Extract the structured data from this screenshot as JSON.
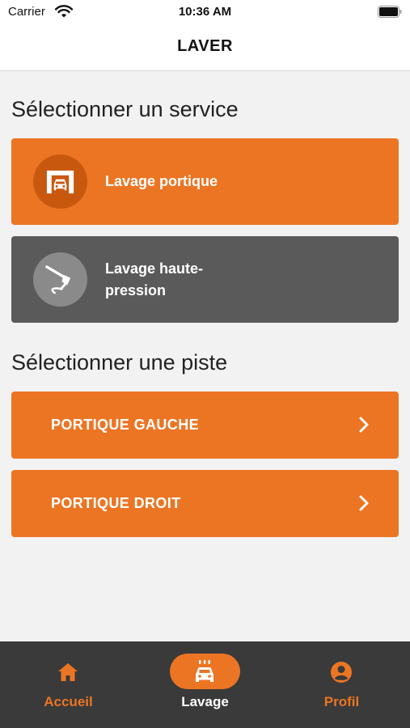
{
  "status_bar": {
    "carrier": "Carrier",
    "time": "10:36 AM"
  },
  "nav": {
    "title": "LAVER"
  },
  "service_section": {
    "heading": "Sélectionner un service",
    "services": [
      {
        "label": "Lavage portique",
        "icon": "car-wash-gantry-icon",
        "selected": true,
        "color": "#ec7524"
      },
      {
        "label": "Lavage haute-\npression",
        "icon": "pressure-washer-icon",
        "selected": false,
        "color": "#5a5a5a"
      }
    ]
  },
  "track_section": {
    "heading": "Sélectionner une piste",
    "tracks": [
      {
        "label": "PORTIQUE GAUCHE"
      },
      {
        "label": "PORTIQUE DROIT"
      }
    ]
  },
  "tab_bar": {
    "tabs": [
      {
        "label": "Accueil",
        "icon": "home-icon",
        "active": false
      },
      {
        "label": "Lavage",
        "icon": "car-wash-icon",
        "active": true
      },
      {
        "label": "Profil",
        "icon": "profile-icon",
        "active": false
      }
    ]
  },
  "colors": {
    "accent": "#ec7524",
    "dark_card": "#5a5a5a",
    "tab_bar": "#3a3a3a",
    "background": "#f2f2f2"
  }
}
